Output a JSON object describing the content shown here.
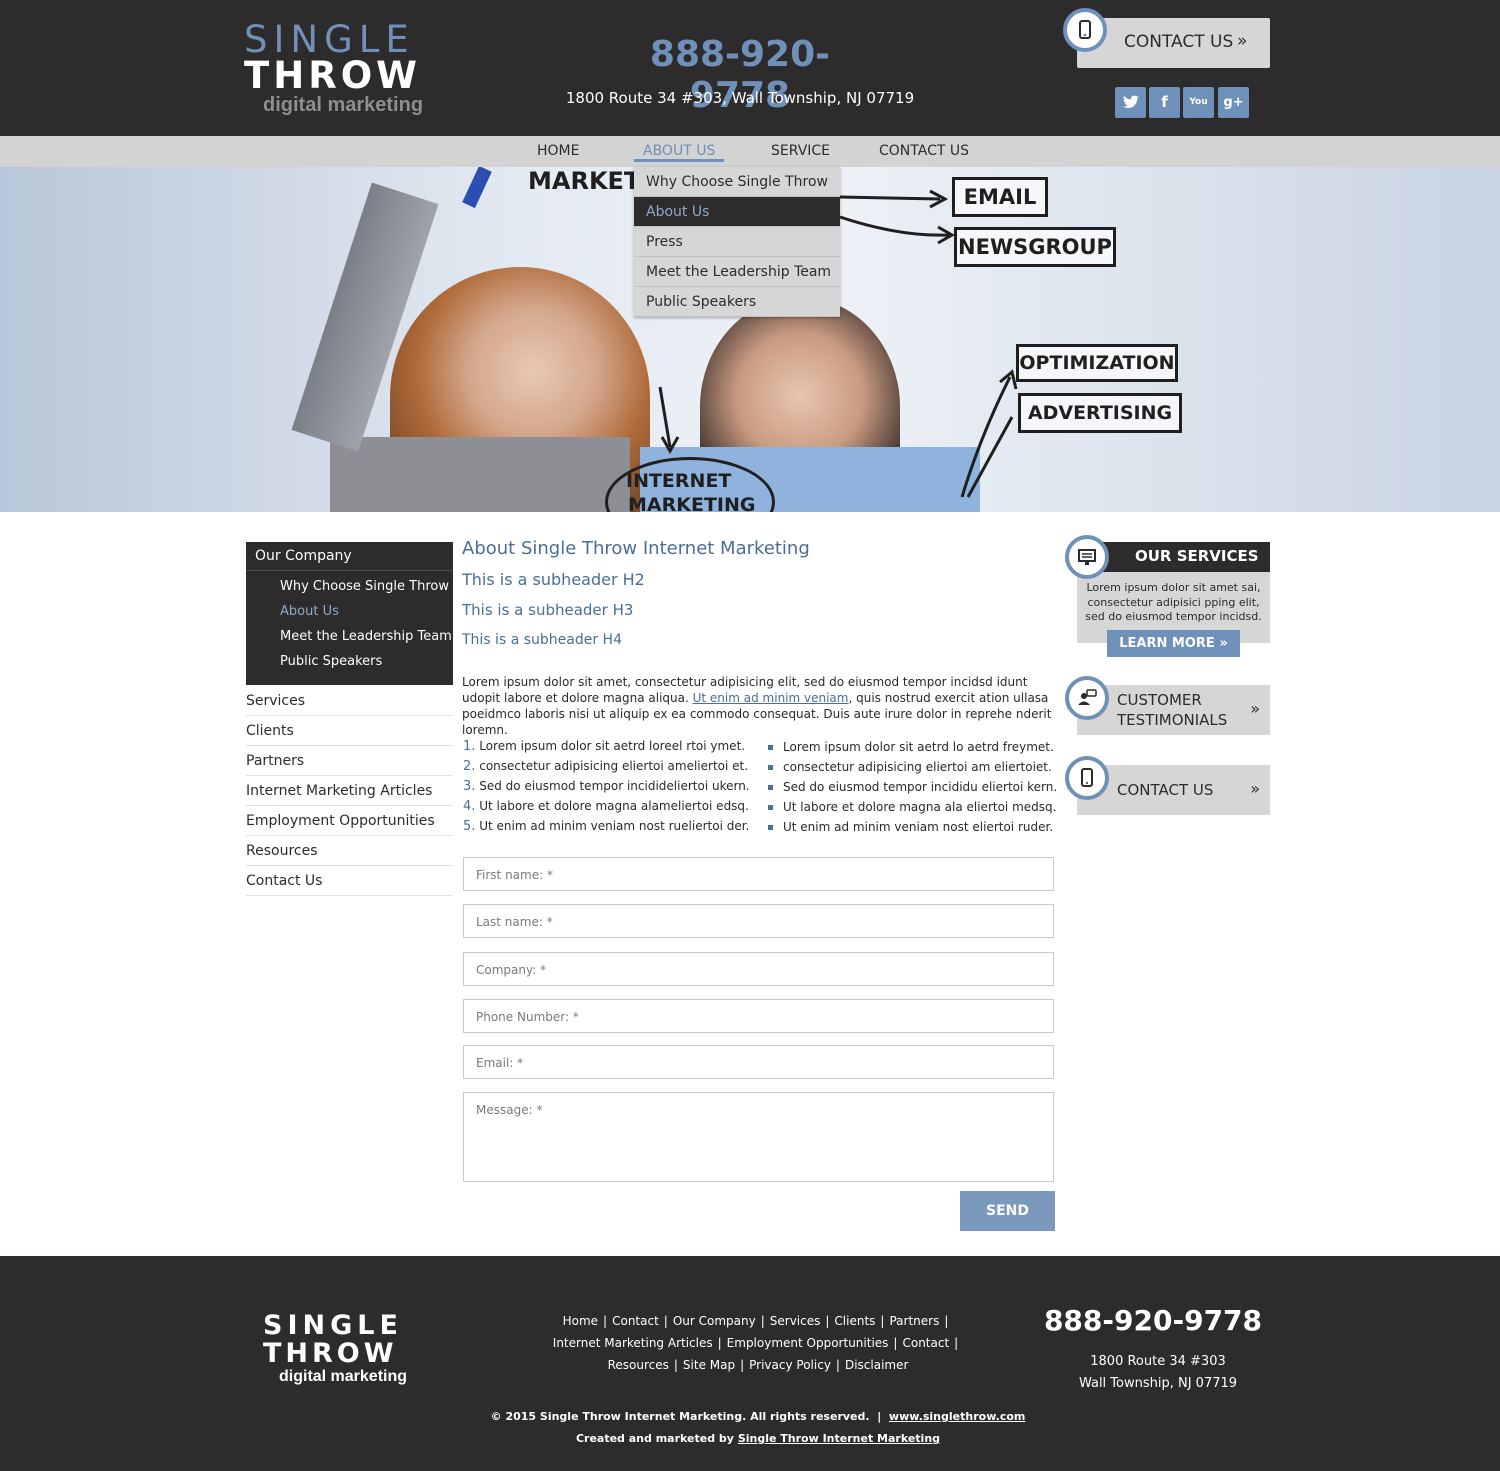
{
  "header": {
    "logo": {
      "line1": "SINGLE",
      "line2": "THROW",
      "line3": "digital marketing"
    },
    "phone": "888-920-9778",
    "address": "1800 Route 34 #303, Wall Township, NJ 07719",
    "contact_button": "CONTACT US",
    "social": [
      {
        "name": "twitter",
        "glyph": "t"
      },
      {
        "name": "facebook",
        "glyph": "f"
      },
      {
        "name": "youtube",
        "glyph": "You"
      },
      {
        "name": "google-plus",
        "glyph": "g+"
      }
    ]
  },
  "nav": {
    "items": [
      "HOME",
      "ABOUT US",
      "SERVICE",
      "CONTACT US"
    ],
    "active": "ABOUT US",
    "dropdown": [
      "Why Choose Single Throw",
      "About Us",
      "Press",
      "Meet the Leadership Team",
      "Public Speakers"
    ]
  },
  "hero": {
    "labels": [
      "MARKET",
      "EMAIL",
      "NEWSGROUP",
      "OPTIMIZATION",
      "ADVERTISING",
      "INTERNET",
      "MARKETING"
    ]
  },
  "left_sidebar": {
    "heading": "Our Company",
    "sub_items": [
      "Why Choose Single Throw",
      "About Us",
      "Meet the Leadership Team",
      "Public Speakers"
    ],
    "links": [
      "Services",
      "Clients",
      "Partners",
      "Internet Marketing Articles",
      "Employment Opportunities",
      "Resources",
      "Contact Us"
    ]
  },
  "main": {
    "h1": "About Single Throw Internet Marketing",
    "h2": "This is a subheader H2",
    "h3": "This is a subheader H3",
    "h4": "This is a subheader H4",
    "para_a": "Lorem ipsum dolor sit amet, consectetur adipisicing elit, sed do eiusmod tempor incidsd idunt udopit labore et dolore magna aliqua. ",
    "para_link": "Ut enim ad minim veniam",
    "para_b": ", quis nostrud exercit ation ullasa poeidmco laboris nisi ut aliquip ex ea commodo consequat. Duis aute irure dolor in reprehe nderit loremn.",
    "ordered": [
      "Lorem ipsum dolor sit aetrd loreel rtoi  ymet.",
      "consectetur adipisicing eliertoi ameliertoi et.",
      "Sed do eiusmod tempor incidideliertoi ukern.",
      "Ut labore et dolore magna alameliertoi edsq.",
      "Ut enim ad minim veniam nost rueliertoi der."
    ],
    "bullets": [
      "Lorem ipsum dolor sit aetrd lo aetrd freymet.",
      "consectetur adipisicing eliertoi am eliertoiet.",
      "Sed do eiusmod tempor incididu eliertoi kern.",
      "Ut labore et dolore magna ala eliertoi medsq.",
      "Ut enim ad minim veniam nost eliertoi ruder."
    ],
    "form": {
      "first_name": "First name: *",
      "last_name": "Last name: *",
      "company": "Company: *",
      "phone": "Phone Number: *",
      "email": "Email: *",
      "message": "Message: *",
      "send": "SEND"
    }
  },
  "right_sidebar": {
    "services_title": "OUR SERVICES",
    "services_text": "Lorem ipsum dolor sit amet sai, consectetur adipisici pping elit, sed do eiusmod tempor incidsd.",
    "learn_more": "LEARN MORE",
    "testimonials_line1": "CUSTOMER",
    "testimonials_line2": "TESTIMONIALS",
    "contact": "CONTACT US"
  },
  "footer": {
    "logo": {
      "line1": "SINGLE",
      "line2": "THROW",
      "line3": "digital marketing"
    },
    "links_row1": [
      "Home",
      "Contact",
      "Our Company",
      "Services",
      "Clients",
      "Partners"
    ],
    "links_row2": [
      "Internet Marketing Articles",
      "Employment Opportunities",
      "Contact"
    ],
    "links_row3": [
      "Resources",
      "Site Map",
      "Privacy Policy",
      "Disclaimer"
    ],
    "phone": "888-920-9778",
    "address_line1": "1800 Route 34 #303",
    "address_line2": "Wall Township, NJ 07719",
    "copyright": "© 2015 Single Throw Internet Marketing. All rights reserved.",
    "website": "www.singlethrow.com",
    "created_by": "Created and marketed by ",
    "created_link": "Single Throw Internet Marketing"
  },
  "colors": {
    "accent": "#6f90b8",
    "dark": "#2d2b2c",
    "light_gray": "#d6d6d6"
  }
}
